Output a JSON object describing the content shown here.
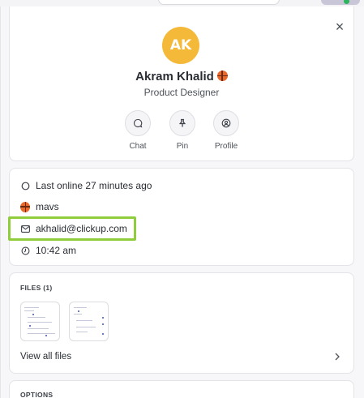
{
  "close_label": "×",
  "profile": {
    "initials": "AK",
    "name": "Akram Khalid",
    "title": "Product Designer",
    "avatar_color": "#f5b93a"
  },
  "actions": [
    {
      "label": "Chat",
      "icon": "chat-bubble-icon"
    },
    {
      "label": "Pin",
      "icon": "pin-icon"
    },
    {
      "label": "Profile",
      "icon": "user-icon"
    }
  ],
  "info": {
    "last_online": "Last online 27 minutes ago",
    "team": "mavs",
    "email": "akhalid@clickup.com",
    "local_time": "10:42 am"
  },
  "files": {
    "title": "FILES (1)",
    "view_all": "View all files"
  },
  "options": {
    "title": "OPTIONS"
  },
  "colors": {
    "highlight": "#8fcd3c",
    "accent": "#f5b93a"
  }
}
